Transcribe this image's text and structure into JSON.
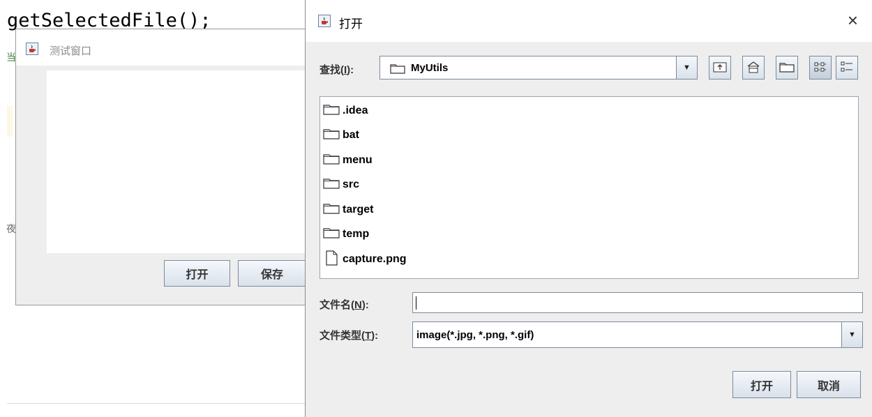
{
  "editor": {
    "code_line": "getSelectedFile();",
    "gutter_glyph_top": "当",
    "gutter_glyph_mid": "夜"
  },
  "test_window": {
    "title": "测试窗口",
    "open_button": "打开",
    "save_button": "保存"
  },
  "dialog": {
    "title": "打开",
    "close_glyph": "×",
    "look_in": {
      "prefix": "查找(",
      "mnemonic": "I",
      "suffix": "):"
    },
    "current_folder": "MyUtils",
    "files": [
      {
        "name": ".idea",
        "type": "folder"
      },
      {
        "name": "bat",
        "type": "folder"
      },
      {
        "name": "menu",
        "type": "folder"
      },
      {
        "name": "src",
        "type": "folder"
      },
      {
        "name": "target",
        "type": "folder"
      },
      {
        "name": "temp",
        "type": "folder"
      },
      {
        "name": "capture.png",
        "type": "file"
      }
    ],
    "filename_label": {
      "prefix": "文件名(",
      "mnemonic": "N",
      "suffix": "):"
    },
    "filename_value": "",
    "filetype_label": {
      "prefix": "文件类型(",
      "mnemonic": "T",
      "suffix": "):"
    },
    "filetype_value": "image(*.jpg, *.png, *.gif)",
    "open_button": "打开",
    "cancel_button": "取消"
  },
  "icons": {
    "toolbar": [
      "up-folder-icon",
      "home-icon",
      "new-folder-icon",
      "list-view-icon",
      "details-view-icon"
    ],
    "app": "java-cup-icon"
  },
  "colors": {
    "dialog_bg": "#eeeeee",
    "border": "#7a8a9c",
    "button_top": "#f5f8fc",
    "button_bottom": "#d9e1ea"
  }
}
